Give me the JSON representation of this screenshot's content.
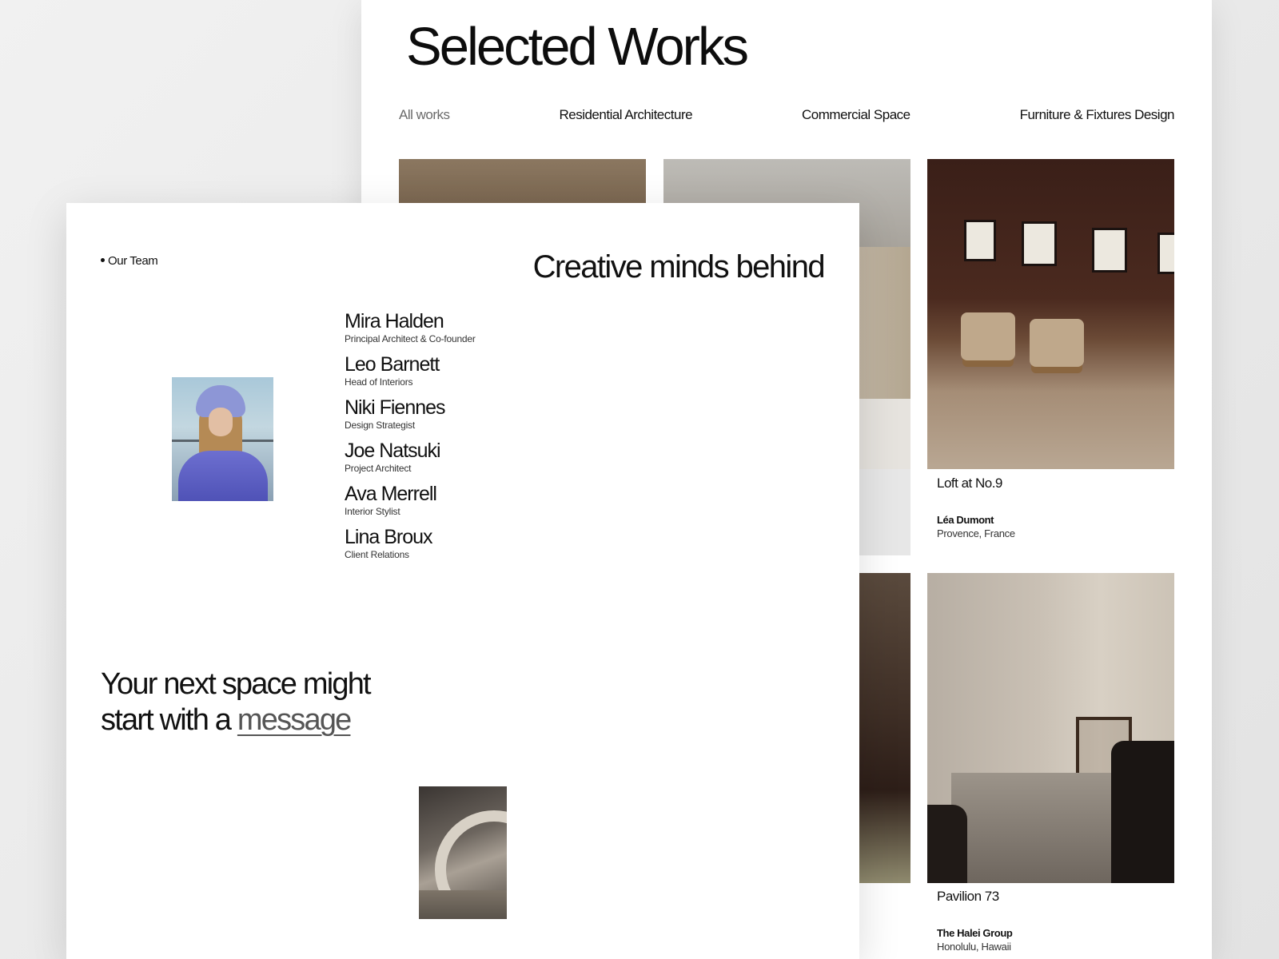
{
  "works": {
    "title": "Selected Works",
    "filters": [
      {
        "label": "All works",
        "active": false
      },
      {
        "label": "Residential Architecture",
        "active": true
      },
      {
        "label": "Commercial Space",
        "active": true
      },
      {
        "label": "Furniture & Fixtures Design",
        "active": true
      }
    ],
    "projects": [
      {
        "title": "Loft at No.9",
        "client": "Léa Dumont",
        "location": "Provence, France"
      },
      {
        "title": "Pavilion 73",
        "client": "The Halei Group",
        "location": "Honolulu, Hawaii"
      }
    ]
  },
  "team": {
    "label": "Our Team",
    "heading": "Creative minds behind",
    "members": [
      {
        "name": "Mira Halden",
        "role": "Principal Architect & Co-founder"
      },
      {
        "name": "Leo Barnett",
        "role": "Head of Interiors"
      },
      {
        "name": "Niki Fiennes",
        "role": "Design Strategist"
      },
      {
        "name": "Joe Natsuki",
        "role": "Project Architect"
      },
      {
        "name": "Ava Merrell",
        "role": "Interior Stylist"
      },
      {
        "name": "Lina Broux",
        "role": "Client Relations"
      }
    ]
  },
  "cta": {
    "line1": "Your next space might",
    "line2_prefix": "start with a ",
    "link": "message"
  },
  "icons": [
    "bullet-dot-icon"
  ],
  "colors": {
    "text": "#111111",
    "muted": "#6a6a6a",
    "link": "#555555",
    "card": "#ffffff"
  }
}
